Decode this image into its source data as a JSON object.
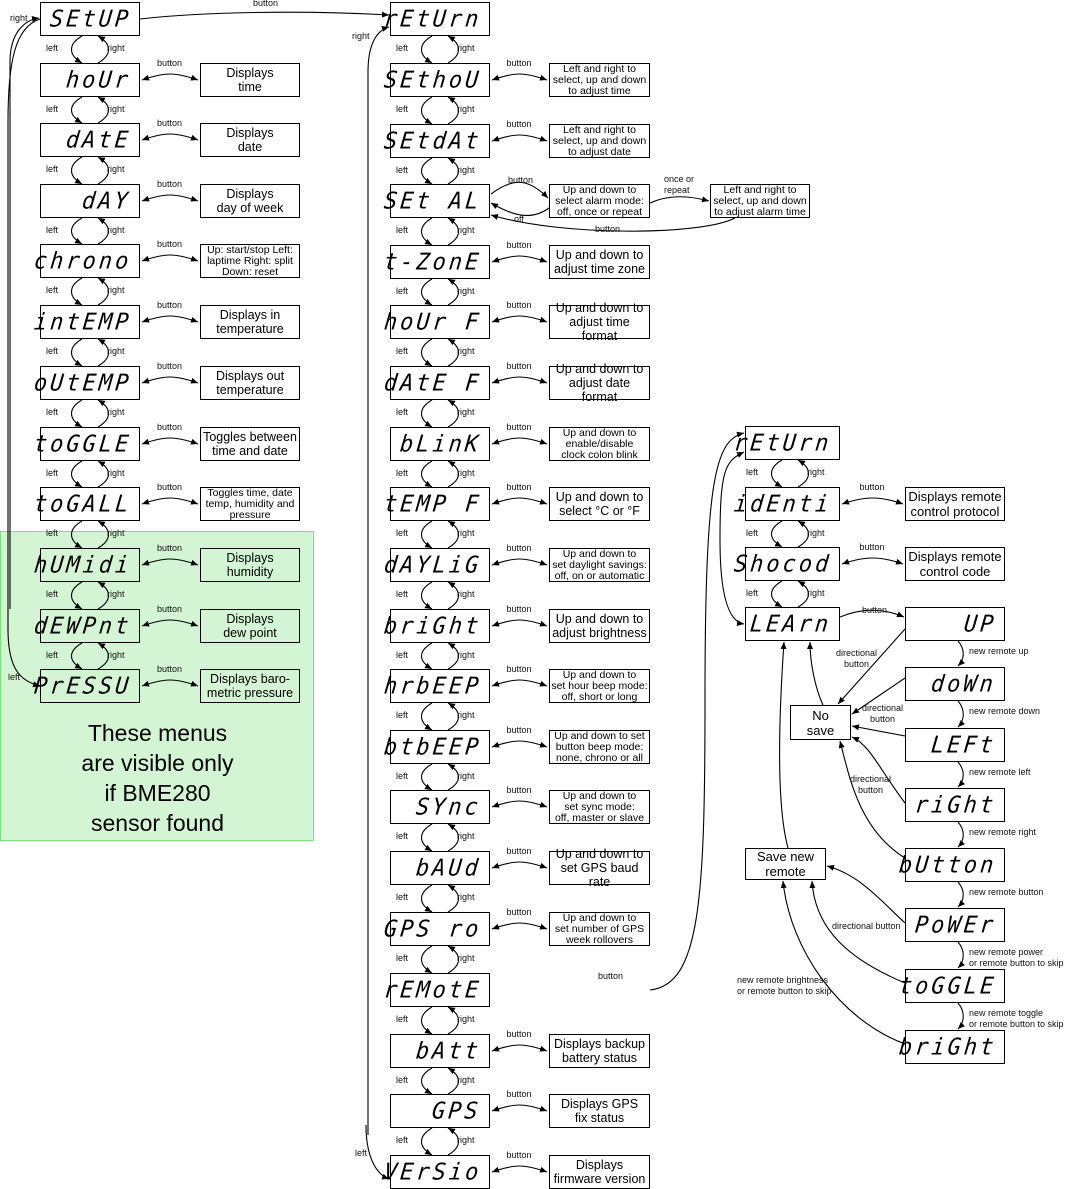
{
  "bme280_note": {
    "text": "These menus\nare visible only\nif BME280\nsensor found",
    "color": "#d3f5d3"
  },
  "edge_labels": {
    "left": "left",
    "right": "right",
    "button": "button",
    "off": "off",
    "once_or_repeat": "once or\nrepeat",
    "directional_button": "directional\nbutton",
    "directional_button_inline": "directional button",
    "new_remote_up": "new remote up",
    "new_remote_down": "new remote down",
    "new_remote_left": "new remote left",
    "new_remote_right": "new remote right",
    "new_remote_button": "new remote button",
    "new_remote_power": "new remote power\nor remote button to skip",
    "new_remote_toggle": "new remote toggle\nor remote button to skip",
    "new_remote_brightness": "new remote brightness\nor remote button to skip"
  },
  "main_menu": [
    {
      "display": "SEtUP",
      "description": null
    },
    {
      "display": "hoUr",
      "description": "Displays\ntime"
    },
    {
      "display": "dAtE",
      "description": "Displays\ndate"
    },
    {
      "display": "dAY",
      "description": "Displays\nday of week"
    },
    {
      "display": "chrono",
      "description": "Up: start/stop Left:\nlaptime Right: split\nDown: reset"
    },
    {
      "display": "intEMP",
      "description": "Displays in\ntemperature"
    },
    {
      "display": "oUtEMP",
      "description": "Displays out\ntemperature"
    },
    {
      "display": "toGGLE",
      "description": "Toggles between\ntime and date"
    },
    {
      "display": "toGALL",
      "description": "Toggles time, date\ntemp, humidity and\npressure"
    },
    {
      "display": "hUMidi",
      "description": "Displays\nhumidity"
    },
    {
      "display": "dEWPnt",
      "description": "Displays\ndew point"
    },
    {
      "display": "PrESSU",
      "description": "Displays baro-\nmetric pressure"
    }
  ],
  "setup_menu": [
    {
      "display": "rEtUrn",
      "description": null
    },
    {
      "display": "SEthoU",
      "description": "Left and right to\nselect, up and down\nto adjust time"
    },
    {
      "display": "SEtdAt",
      "description": "Left and right to\nselect, up and down\nto adjust date"
    },
    {
      "display": "SEt AL",
      "description": "Up and down to\nselect alarm mode:\noff, once or repeat"
    },
    {
      "display": "t-ZonE",
      "description": "Up and down to\nadjust time zone"
    },
    {
      "display": "hoUr F",
      "description": "Up and down to\nadjust time format"
    },
    {
      "display": "dAtE F",
      "description": "Up and down to\nadjust date format"
    },
    {
      "display": "bLinK",
      "description": "Up and down to\nenable/disable\nclock colon blink"
    },
    {
      "display": "tEMP F",
      "description": "Up and down to\nselect °C or °F"
    },
    {
      "display": "dAYLiG",
      "description": "Up and down to\nset daylight savings:\noff, on or automatic"
    },
    {
      "display": "briGht",
      "description": "Up and down to\nadjust brightness"
    },
    {
      "display": "hrbEEP",
      "description": "Up and down to\nset hour beep mode:\noff, short or long"
    },
    {
      "display": "btbEEP",
      "description": "Up and down to set\nbutton beep mode:\nnone, chrono or all"
    },
    {
      "display": "SYnc",
      "description": "Up and down to\nset sync mode:\noff, master or slave"
    },
    {
      "display": "bAUd",
      "description": "Up and down to\nset GPS baud rate"
    },
    {
      "display": "GPS ro",
      "description": "Up and down to\nset number of GPS\nweek rollovers"
    },
    {
      "display": "rEMotE",
      "description": null
    },
    {
      "display": "bAtt",
      "description": "Displays backup\nbattery status"
    },
    {
      "display": "GPS",
      "description": "Displays GPS\nfix status"
    },
    {
      "display": "VErSio",
      "description": "Displays\nfirmware version"
    }
  ],
  "alarm_time_description": "Left and right to\nselect, up and down\nto adjust alarm time",
  "remote_menu": [
    {
      "display": "rEtUrn",
      "description": null
    },
    {
      "display": "idEnti",
      "description": "Displays remote\ncontrol protocol"
    },
    {
      "display": "Shocod",
      "description": "Displays remote\ncontrol code"
    },
    {
      "display": "LEArn",
      "description": null
    }
  ],
  "learn_sequence": [
    "UP",
    "doWn",
    "LEFt",
    "riGht",
    "bUtton",
    "PoWEr",
    "toGGLE",
    "briGht"
  ],
  "no_save_label": "No\nsave",
  "save_new_remote_label": "Save new\nremote"
}
